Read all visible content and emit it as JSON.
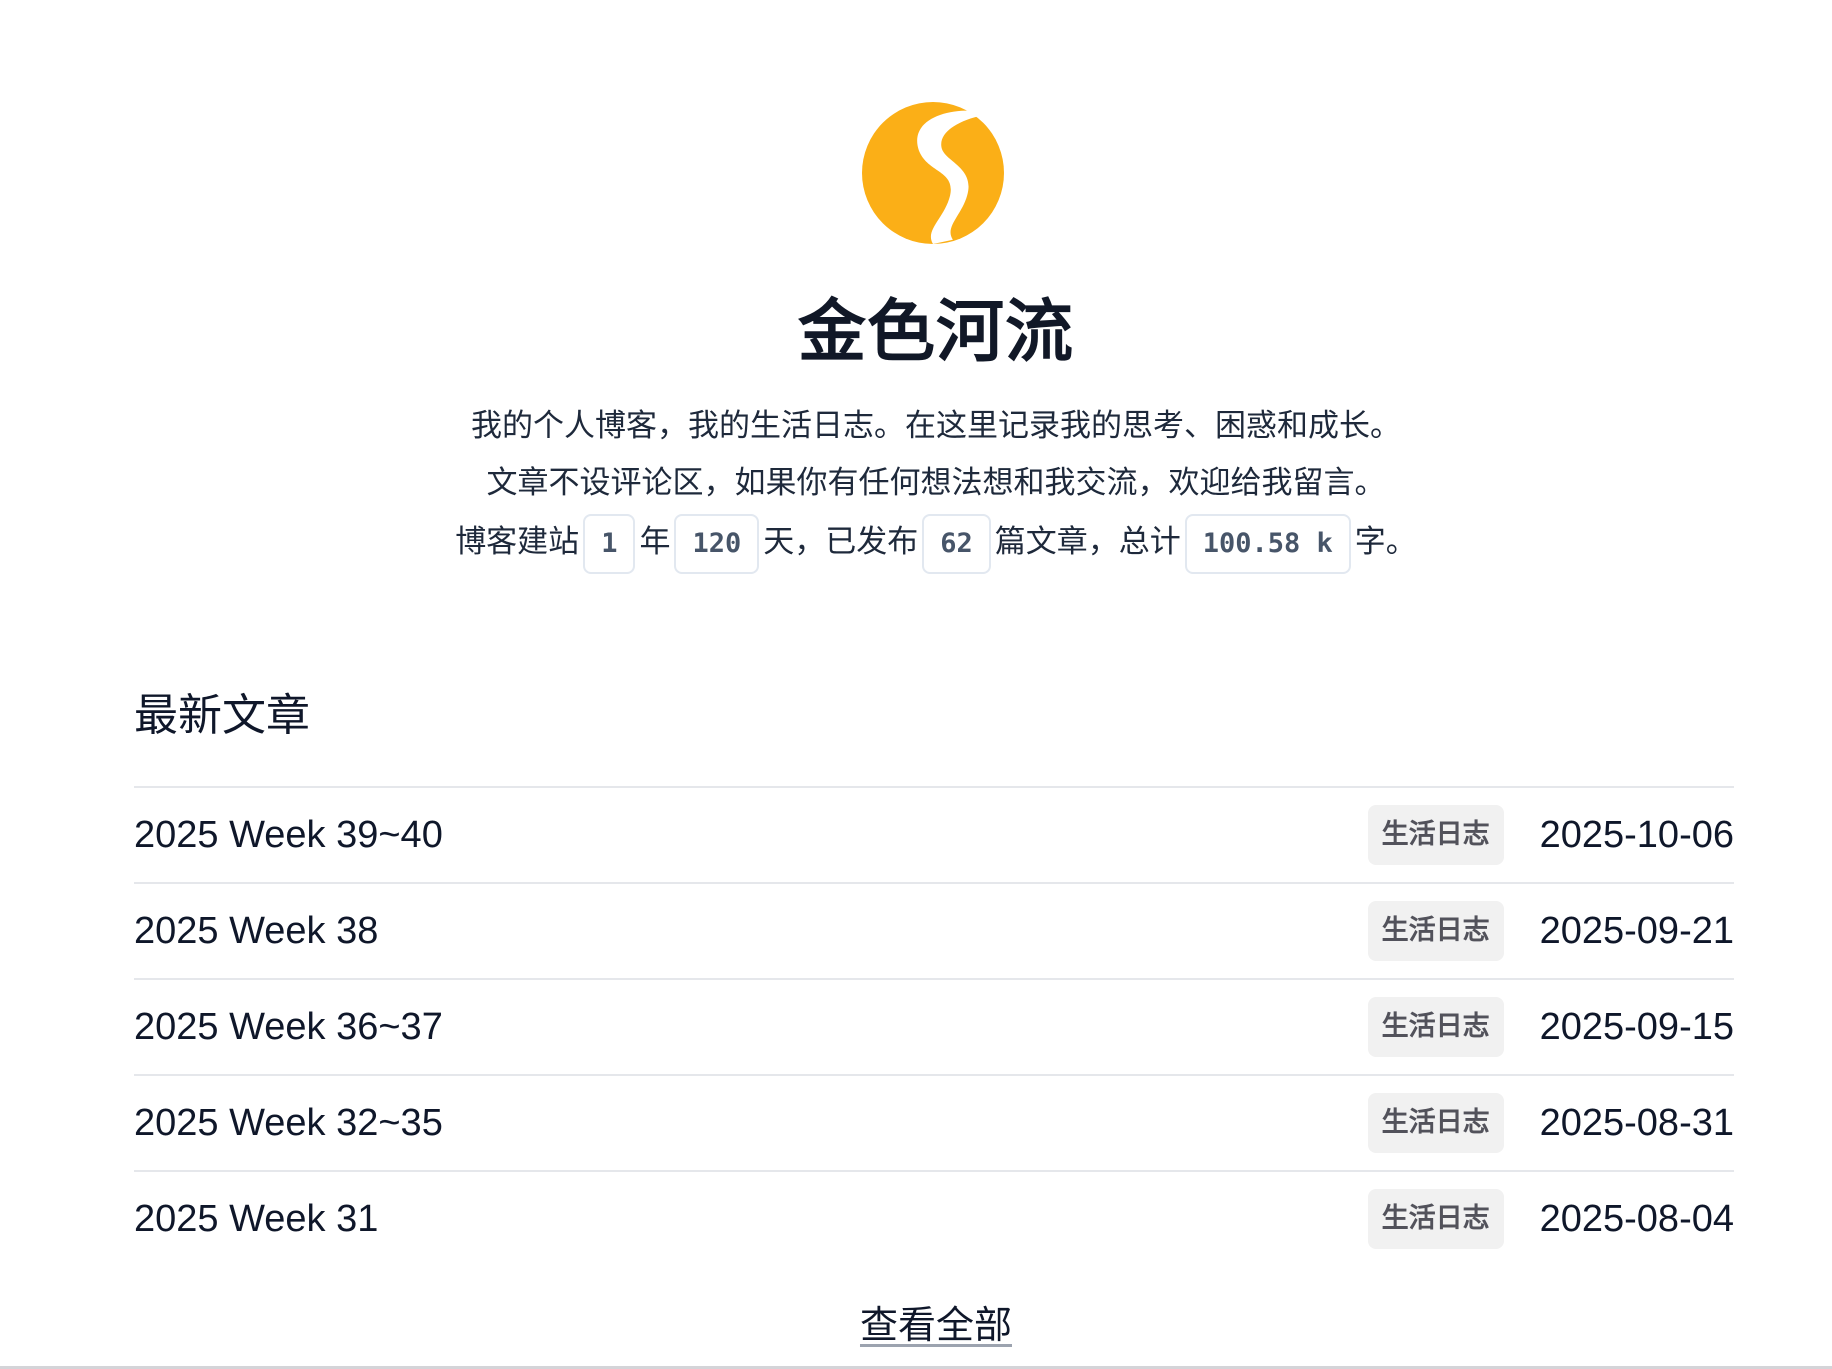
{
  "site": {
    "title": "金色河流",
    "logo_icon": "golden-river-logo-icon",
    "logo_color": "#FBAF17",
    "intro_line1": "我的个人博客，我的生活日志。在这里记录我的思考、困惑和成长。",
    "intro_line2": "文章不设评论区，如果你有任何想法想和我交流，欢迎给我留言。"
  },
  "stats": {
    "prefix": "博客建站",
    "years": "1",
    "years_unit": "年",
    "days": "120",
    "days_unit": "天，已发布",
    "posts": "62",
    "posts_unit": "篇文章，总计",
    "words": "100.58 k",
    "words_unit": "字。"
  },
  "latest": {
    "heading": "最新文章",
    "view_all_label": "查看全部",
    "posts": [
      {
        "title": "2025 Week 39~40",
        "tag": "生活日志",
        "date": "2025-10-06"
      },
      {
        "title": "2025 Week 38",
        "tag": "生活日志",
        "date": "2025-09-21"
      },
      {
        "title": "2025 Week 36~37",
        "tag": "生活日志",
        "date": "2025-09-15"
      },
      {
        "title": "2025 Week 32~35",
        "tag": "生活日志",
        "date": "2025-08-31"
      },
      {
        "title": "2025 Week 31",
        "tag": "生活日志",
        "date": "2025-08-04"
      }
    ]
  }
}
